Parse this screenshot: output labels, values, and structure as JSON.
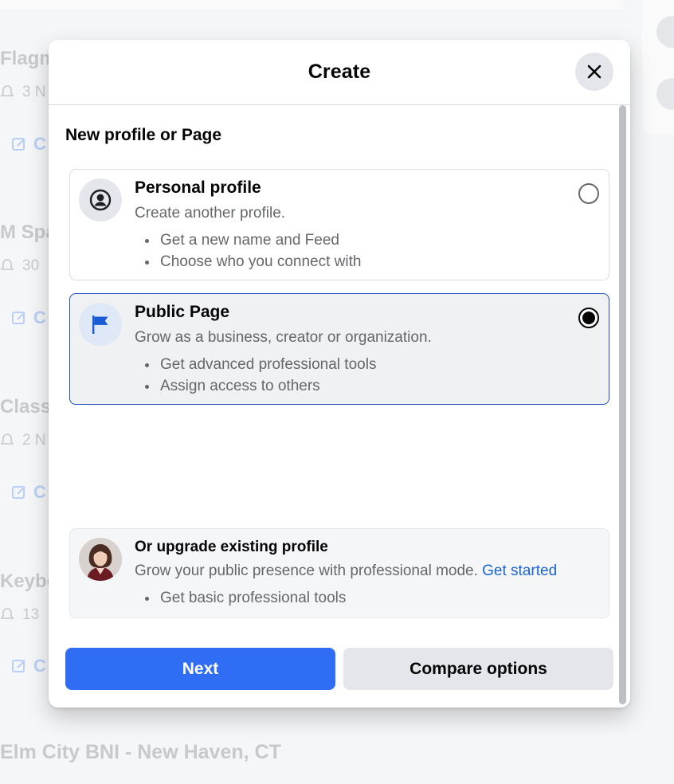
{
  "background": {
    "groups": [
      {
        "title": "Flagm",
        "subtitle": "3 N",
        "action": "C"
      },
      {
        "title": "M Spa",
        "subtitle": "30",
        "action": "C"
      },
      {
        "title": "Class",
        "subtitle": "2 N",
        "action": "C"
      },
      {
        "title": "Keybo",
        "subtitle": "13",
        "action": "C"
      }
    ],
    "bottom_title": "Elm City BNI - New Haven, CT"
  },
  "modal": {
    "title": "Create",
    "close_icon": "close-icon",
    "section_title": "New profile or Page",
    "options": [
      {
        "title": "Personal profile",
        "description": "Create another profile.",
        "bullets": [
          "Get a new name and Feed",
          "Choose who you connect with"
        ],
        "icon": "person-circle-icon",
        "selected": false
      },
      {
        "title": "Public Page",
        "description": "Grow as a business, creator or organization.",
        "bullets": [
          "Get advanced professional tools",
          "Assign access to others"
        ],
        "icon": "flag-icon",
        "selected": true
      }
    ],
    "upgrade": {
      "title": "Or upgrade existing profile",
      "description": "Grow your public presence with professional mode.",
      "link": "Get started",
      "bullets": [
        "Get basic professional tools"
      ]
    },
    "buttons": {
      "next": "Next",
      "compare": "Compare options"
    },
    "colors": {
      "primary": "#2f6df4",
      "link": "#1a63d8",
      "selected_border": "#1b4fbd"
    }
  }
}
